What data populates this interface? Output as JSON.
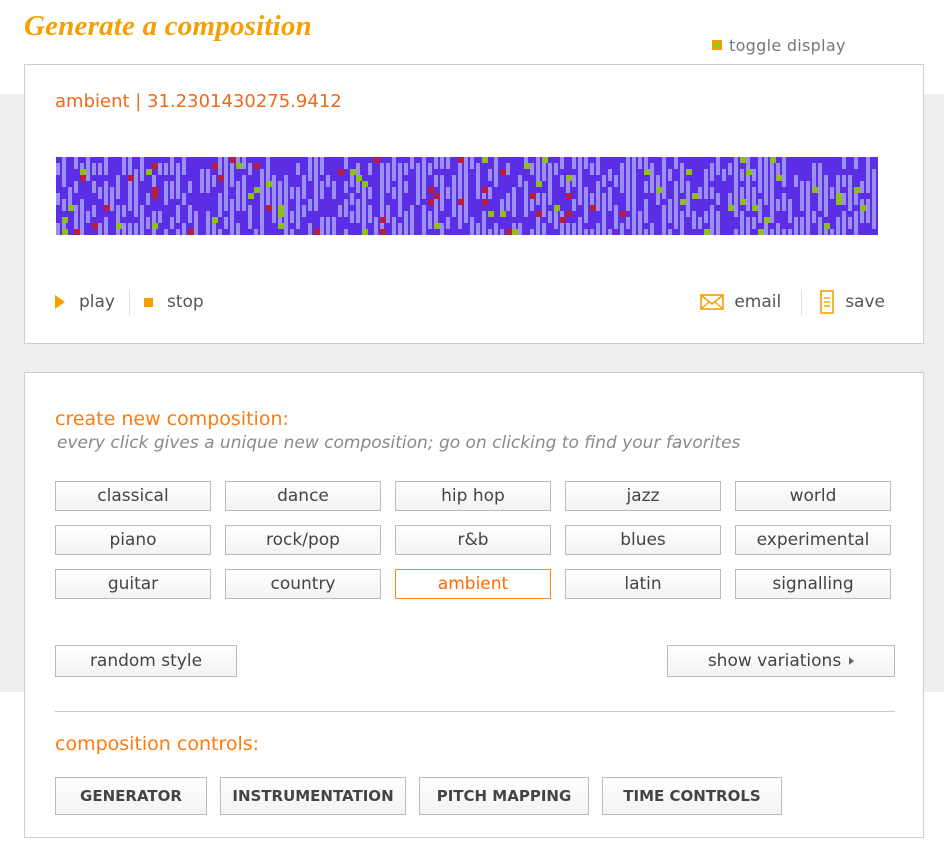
{
  "header": {
    "title": "Generate a composition",
    "toggle_display": "toggle display"
  },
  "composition": {
    "title": "ambient | 31.2301430275.9412",
    "visual_colors": {
      "background": "#5b2ee6",
      "note": "#9b8ff2",
      "accent_green": "#8fc01a",
      "accent_red": "#b81c3c"
    }
  },
  "transport": {
    "play": "play",
    "stop": "stop",
    "email": "email",
    "save": "save"
  },
  "create": {
    "title": "create new composition:",
    "subtitle": "every click gives a unique new composition; go on clicking to find your favorites",
    "styles": [
      "classical",
      "dance",
      "hip hop",
      "jazz",
      "world",
      "piano",
      "rock/pop",
      "r&b",
      "blues",
      "experimental",
      "guitar",
      "country",
      "ambient",
      "latin",
      "signalling"
    ],
    "active_style": "ambient",
    "random_style": "random style",
    "show_variations": "show variations"
  },
  "controls": {
    "title": "composition controls:",
    "buttons": [
      "GENERATOR",
      "INSTRUMENTATION",
      "PITCH MAPPING",
      "TIME CONTROLS"
    ]
  },
  "colors": {
    "title_orange": "#f5a000",
    "accent_orange": "#ff7a0f",
    "text_gray": "#555555"
  }
}
